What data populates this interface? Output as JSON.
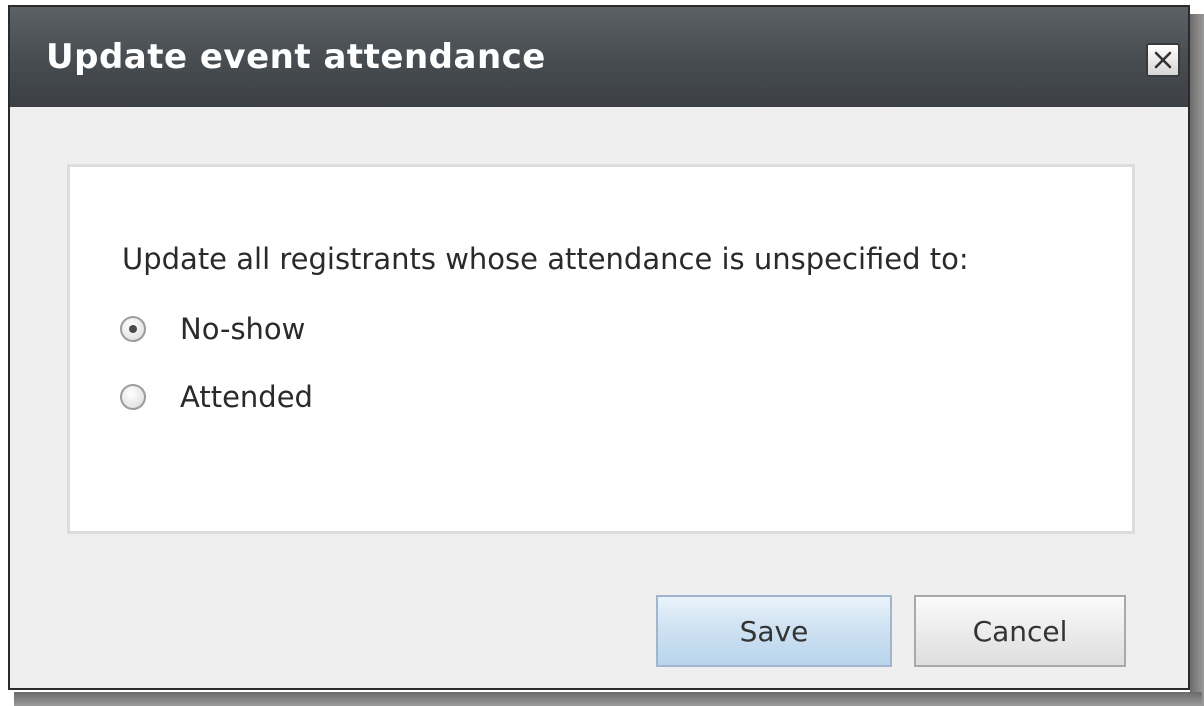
{
  "dialog": {
    "title": "Update event attendance",
    "close_icon": "close-icon",
    "prompt": "Update all registrants whose attendance is unspecified to:",
    "options": [
      {
        "label": "No-show",
        "selected": true
      },
      {
        "label": "Attended",
        "selected": false
      }
    ],
    "buttons": {
      "save_label": "Save",
      "cancel_label": "Cancel"
    }
  },
  "colors": {
    "titlebar": "#474c51",
    "title_text": "#ffffff",
    "save_button": "#cfe2f2",
    "panel_border": "#dcdcdc"
  }
}
